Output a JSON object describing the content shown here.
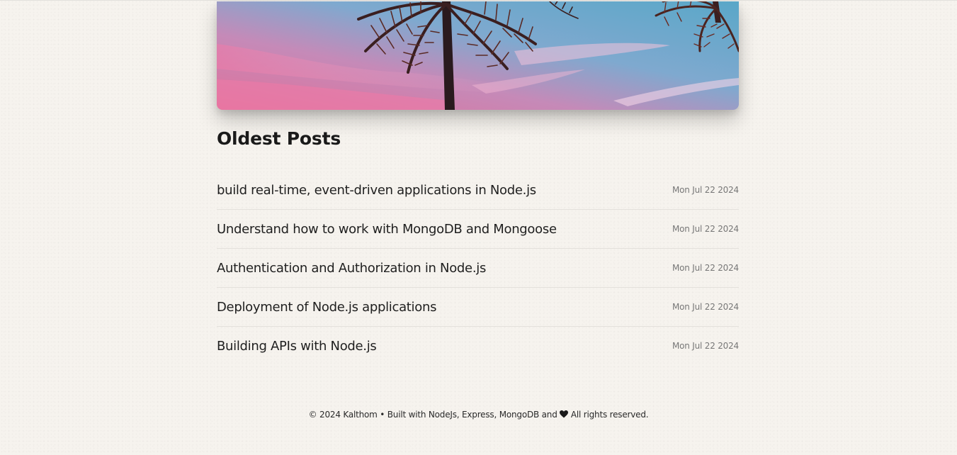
{
  "hero": {
    "image": "palm-trees-at-sunset"
  },
  "oldest_posts": {
    "heading": "Oldest Posts",
    "posts": [
      {
        "title": "build real-time, event-driven applications in Node.js",
        "date": "Mon Jul 22 2024"
      },
      {
        "title": "Understand how to work with MongoDB and Mongoose",
        "date": "Mon Jul 22 2024"
      },
      {
        "title": "Authentication and Authorization in Node.js",
        "date": "Mon Jul 22 2024"
      },
      {
        "title": "Deployment of Node.js applications",
        "date": "Mon Jul 22 2024"
      },
      {
        "title": "Building APIs with Node.js",
        "date": "Mon Jul 22 2024"
      }
    ]
  },
  "footer": {
    "text_before": "© 2024 Kalthom • Built with NodeJs, Express, MongoDB and",
    "heart_icon": "heart-icon",
    "text_after": "All rights reserved."
  }
}
